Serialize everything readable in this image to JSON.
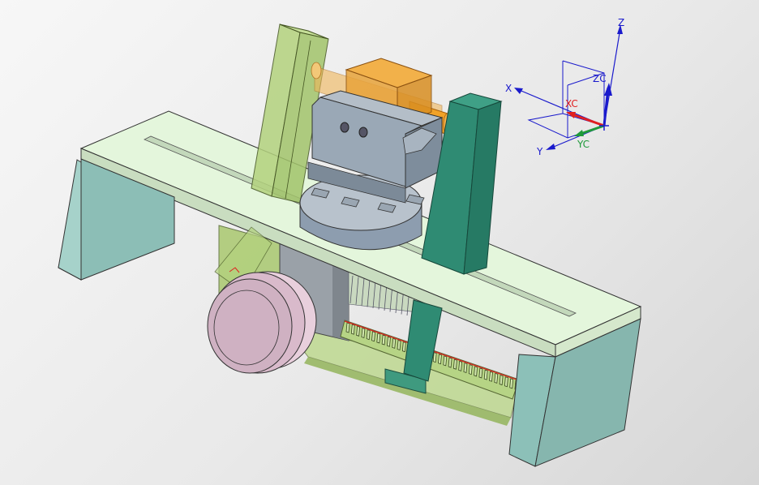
{
  "viewport": {
    "background_top": "#f7f7f7",
    "background_bottom": "#d6d6d6"
  },
  "triad": {
    "absolute_axes": {
      "x_label": "X",
      "y_label": "Y",
      "z_label": "Z",
      "color": "#1a1acc"
    },
    "working_axes": {
      "xc_label": "XC",
      "yc_label": "YC",
      "zc_label": "ZC",
      "xc_color": "#e02020",
      "yc_color": "#1f9a3a",
      "zc_color": "#1a1acc"
    }
  },
  "model": {
    "parts": [
      {
        "name": "base-slab-top",
        "color": "#e4f6dc"
      },
      {
        "name": "base-support-leg",
        "color": "#86b8b0"
      },
      {
        "name": "vertical-guide-post",
        "color": "#a8c879"
      },
      {
        "name": "rotary-table",
        "color": "#8d9daf"
      },
      {
        "name": "chuck-block",
        "color": "#8d9daf"
      },
      {
        "name": "orange-slider",
        "color": "#e8a33a"
      },
      {
        "name": "dark-green-column",
        "color": "#2f8b73"
      },
      {
        "name": "handwheel",
        "color": "#d6b4c8"
      },
      {
        "name": "rack-gear",
        "color": "#b6d485"
      }
    ]
  }
}
